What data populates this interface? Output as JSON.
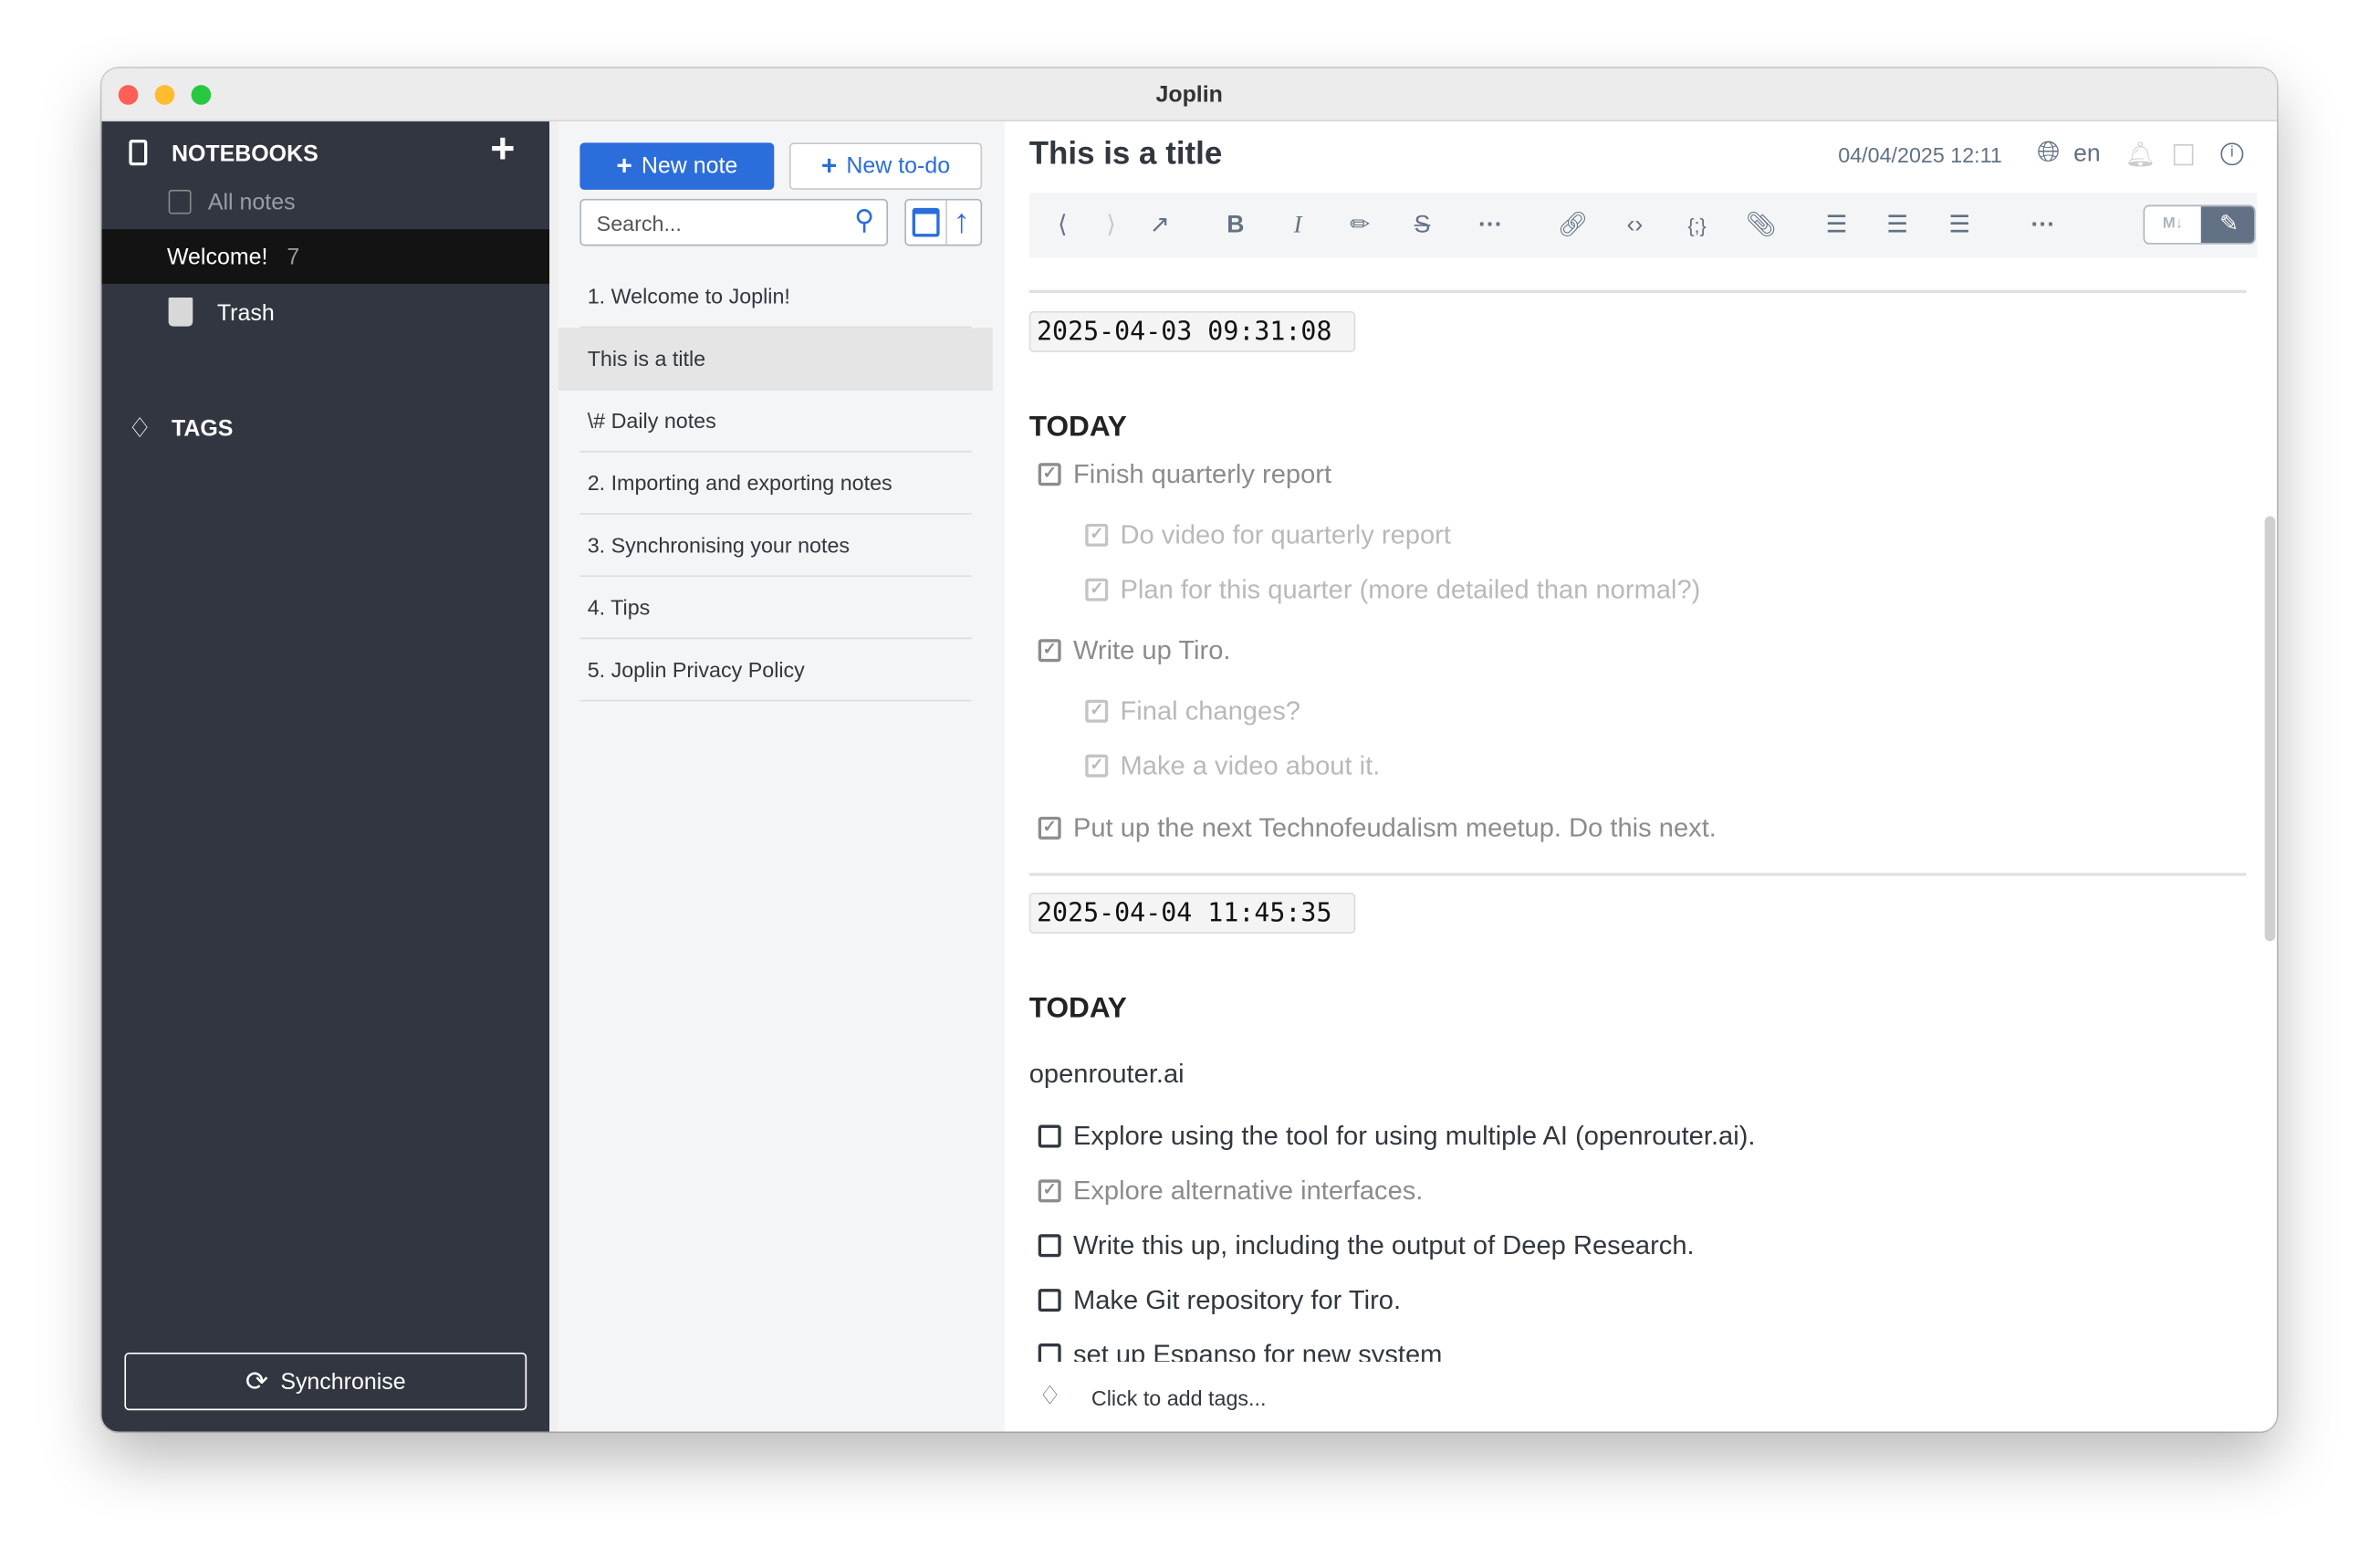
{
  "window": {
    "title": "Joplin"
  },
  "sidebar": {
    "notebooks_label": "NOTEBOOKS",
    "all_notes": "All notes",
    "notebook": {
      "name": "Welcome!",
      "count": "7"
    },
    "trash": "Trash",
    "tags_label": "TAGS",
    "sync_button": "Synchronise"
  },
  "notelist": {
    "new_note": "New note",
    "new_todo": "New to-do",
    "search_placeholder": "Search...",
    "items": [
      "1. Welcome to Joplin!",
      "This is a title",
      "\\# Daily notes",
      "2. Importing and exporting notes",
      "3. Synchronising your notes",
      "4. Tips",
      "5. Joplin Privacy Policy"
    ],
    "selected_index": 1
  },
  "editor": {
    "title": "This is a title",
    "datetime": "04/04/2025 12:11",
    "language": "en",
    "sections": [
      {
        "timestamp": "2025-04-03 09:31:08",
        "heading": "TODAY",
        "tasks": [
          {
            "text": "Finish quarterly report",
            "checked": true,
            "level": 0
          },
          {
            "text": "Do video for quarterly report",
            "checked": true,
            "level": 1
          },
          {
            "text": "Plan for this quarter (more detailed than normal?)",
            "checked": true,
            "level": 1
          },
          {
            "text": "Write up Tiro.",
            "checked": true,
            "level": 0
          },
          {
            "text": "Final changes?",
            "checked": true,
            "level": 1
          },
          {
            "text": "Make a video about it.",
            "checked": true,
            "level": 1
          },
          {
            "text": "Put up the next Technofeudalism meetup. Do this next.",
            "checked": true,
            "level": 0
          }
        ]
      },
      {
        "timestamp": "2025-04-04 11:45:35",
        "heading": "TODAY",
        "paragraph": "openrouter.ai",
        "tasks": [
          {
            "text": "Explore using the tool for using multiple AI (openrouter.ai).",
            "checked": false,
            "level": 0
          },
          {
            "text": "Explore alternative interfaces.",
            "checked": true,
            "level": 0
          },
          {
            "text": "Write this up, including the output of Deep Research.",
            "checked": false,
            "level": 0
          },
          {
            "text": "Make Git repository for Tiro.",
            "checked": false,
            "level": 0
          },
          {
            "text": "set up Espanso for new system",
            "checked": false,
            "level": 0
          }
        ]
      }
    ],
    "tags_placeholder": "Click to add tags..."
  },
  "colors": {
    "accent": "#2b6ddb",
    "sidebar": "#313640",
    "selected_notebook": "#131313",
    "toolbar_icon": "#627184"
  }
}
